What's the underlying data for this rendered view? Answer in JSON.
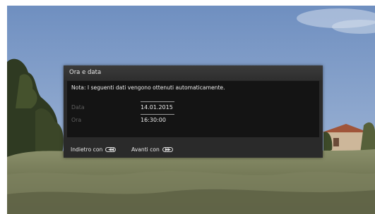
{
  "dialog": {
    "title": "Ora e data",
    "note": "Nota: I seguenti dati vengono ottenuti automaticamente.",
    "date_label": "Data",
    "date_value": "14.01.2015",
    "time_label": "Ora",
    "time_value": "16:30:00"
  },
  "footer": {
    "back_label": "Indietro con",
    "back_icon": "rewind-button-icon",
    "forward_label": "Avanti con",
    "forward_icon": "fast-forward-button-icon"
  },
  "colors": {
    "dialog_bg": "#2a2a2a",
    "panel_bg": "#141414",
    "text_primary": "#ececec",
    "text_muted": "#5e5e5e"
  }
}
